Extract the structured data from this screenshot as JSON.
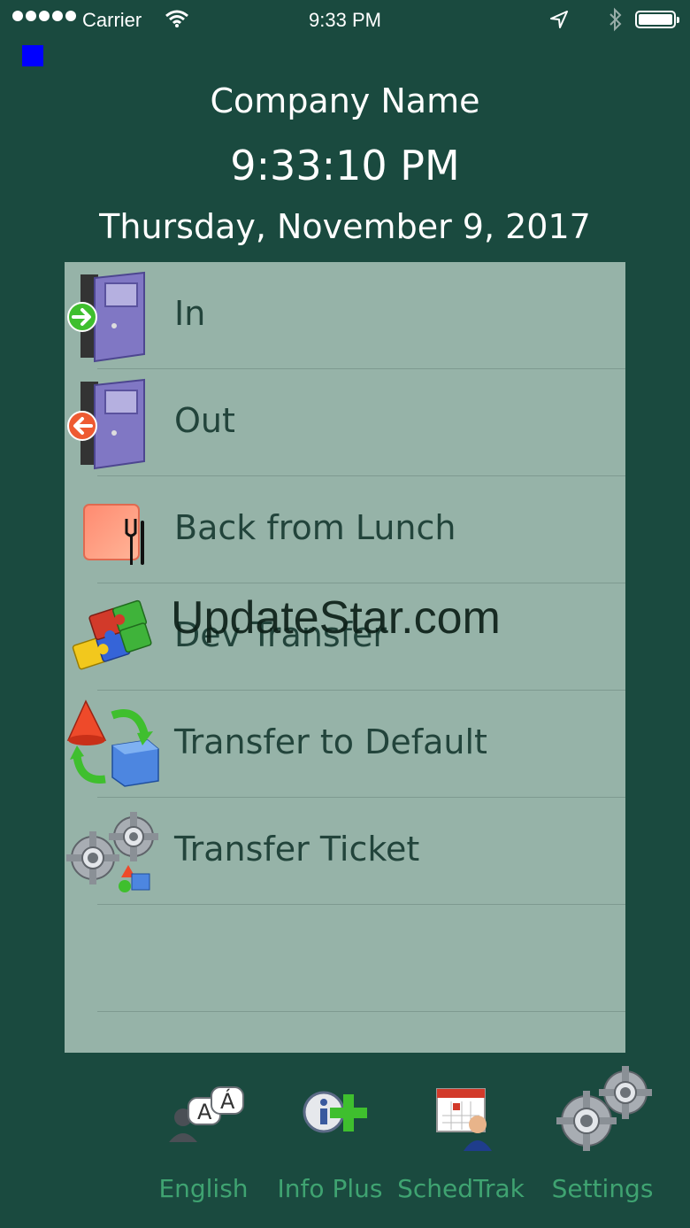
{
  "status_bar": {
    "carrier": "Carrier",
    "time": "9:33 PM"
  },
  "header": {
    "company": "Company Name",
    "clock": "9:33:10 PM",
    "date": "Thursday, November 9, 2017"
  },
  "menu": {
    "items": [
      {
        "label": "In",
        "icon": "door-in-icon"
      },
      {
        "label": "Out",
        "icon": "door-out-icon"
      },
      {
        "label": "Back from Lunch",
        "icon": "lunch-icon"
      },
      {
        "label": "Dev Transfer",
        "icon": "puzzle-icon"
      },
      {
        "label": "Transfer to Default",
        "icon": "shapes-transfer-icon"
      },
      {
        "label": "Transfer Ticket",
        "icon": "gears-ticket-icon"
      }
    ]
  },
  "watermark": "UpdateStar.com",
  "tabs": [
    {
      "label": "English",
      "icon": "language-icon"
    },
    {
      "label": "Info Plus",
      "icon": "info-plus-icon"
    },
    {
      "label": "SchedTrak",
      "icon": "calendar-user-icon"
    },
    {
      "label": "Settings",
      "icon": "gears-icon"
    }
  ],
  "colors": {
    "background": "#1a4a3f",
    "list_background": "#96b3a8",
    "tab_label": "#3fa371",
    "text_light": "#ffffff"
  }
}
